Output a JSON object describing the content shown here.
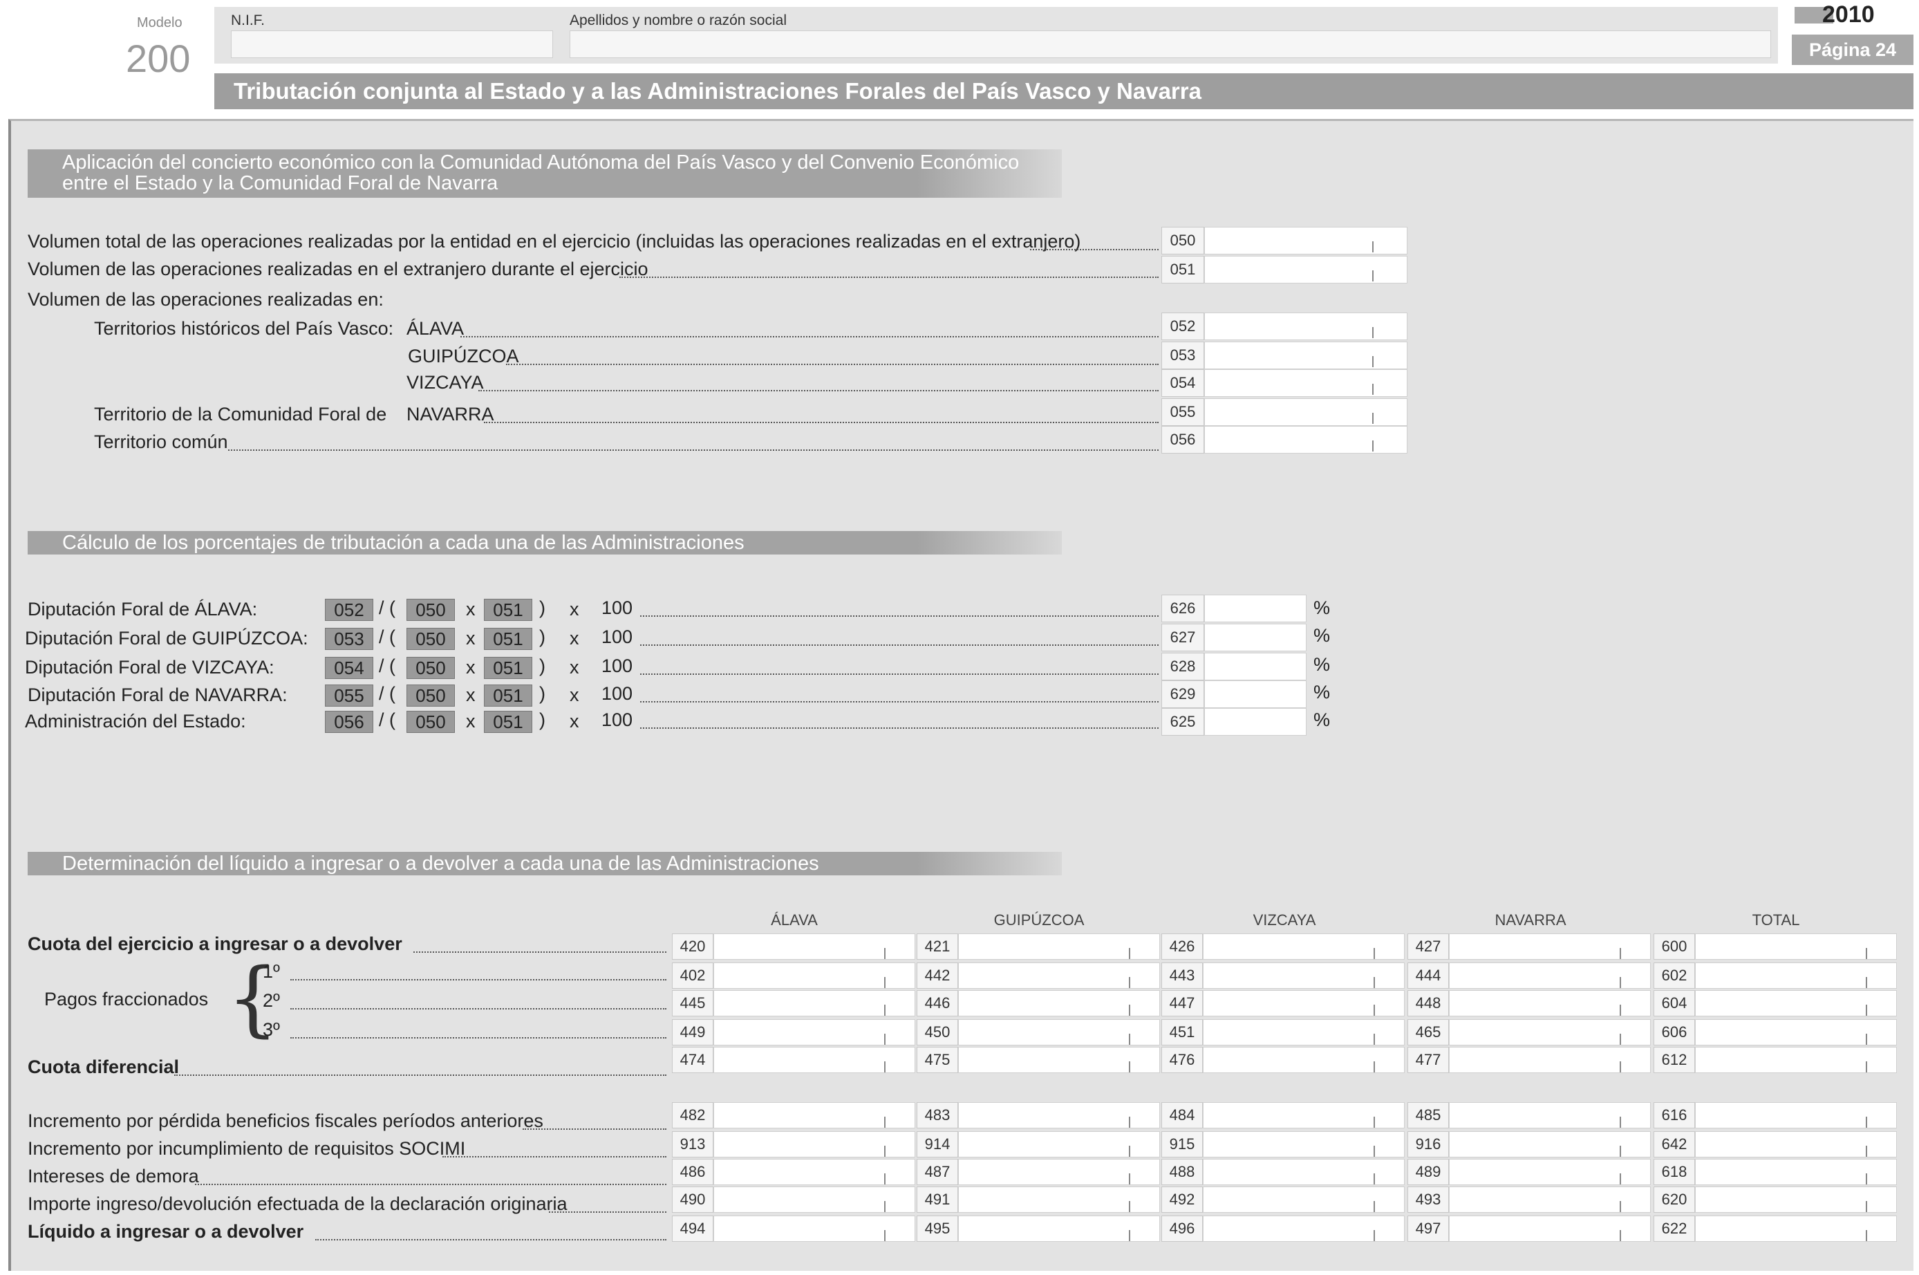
{
  "header": {
    "modelo_label": "Modelo",
    "modelo_number": "200",
    "nif_label": "N.I.F.",
    "name_label": "Apellidos y nombre o razón social",
    "year": "2010",
    "page": "Página 24",
    "title": "Tributación conjunta al Estado y a las Administraciones Forales del País Vasco y Navarra"
  },
  "section1": {
    "title_line1": "Aplicación del concierto económico con la Comunidad Autónoma del País Vasco y del Convenio Económico",
    "title_line2": "entre el Estado y la Comunidad Foral de Navarra",
    "rows": [
      {
        "label": "Volumen total de las operaciones realizadas por la entidad en el ejercicio (incluidas las operaciones realizadas en el extranjero)",
        "code": "050"
      },
      {
        "label": "Volumen de las operaciones realizadas en el extranjero durante el ejercicio",
        "code": "051"
      },
      {
        "label": "ÁLAVA",
        "code": "052"
      },
      {
        "label": "GUIPÚZCOA",
        "code": "053"
      },
      {
        "label": "VIZCAYA",
        "code": "054"
      },
      {
        "label": "NAVARRA",
        "code": "055"
      },
      {
        "label": "Territorio común",
        "code": "056"
      }
    ],
    "volumen_label": "Volumen de las operaciones realizadas en:",
    "pais_vasco_label": "Territorios históricos del País Vasco:",
    "navarra_label": "Territorio de la Comunidad Foral  de"
  },
  "section2": {
    "title": "Cálculo de los porcentajes de tributación a cada una de las Administraciones",
    "rows": [
      {
        "label": "Diputación Foral de ÁLAVA:",
        "ref": "052",
        "a": "050",
        "b": "051",
        "mult": "100",
        "code": "626",
        "unit": "%"
      },
      {
        "label": "Diputación Foral de GUIPÚZCOA:",
        "ref": "053",
        "a": "050",
        "b": "051",
        "mult": "100",
        "code": "627",
        "unit": "%"
      },
      {
        "label": "Diputación Foral de VIZCAYA:",
        "ref": "054",
        "a": "050",
        "b": "051",
        "mult": "100",
        "code": "628",
        "unit": "%"
      },
      {
        "label": "Diputación Foral de NAVARRA:",
        "ref": "055",
        "a": "050",
        "b": "051",
        "mult": "100",
        "code": "629",
        "unit": "%"
      },
      {
        "label": "Administración del Estado:",
        "ref": "056",
        "a": "050",
        "b": "051",
        "mult": "100",
        "code": "625",
        "unit": "%"
      }
    ],
    "op_div": "/ (",
    "op_x": "x",
    "op_close": ")"
  },
  "section3": {
    "title": "Determinación del líquido a ingresar o a devolver a cada una de las Administraciones",
    "columns": [
      "ÁLAVA",
      "GUIPÚZCOA",
      "VIZCAYA",
      "NAVARRA",
      "TOTAL"
    ],
    "cuota_label": "Cuota del ejercicio a ingresar o a devolver",
    "pagos_label": "Pagos fraccionados",
    "p1": "1º",
    "p2": "2º",
    "p3": "3º",
    "cuota_dif_label": "Cuota diferencial",
    "inc1_label": "Incremento por pérdida beneficios fiscales períodos anteriores",
    "inc2_label": "Incremento por incumplimiento de requisitos SOCIMI",
    "intereses_label": "Intereses de demora",
    "importe_label": "Importe ingreso/devolución efectuada de la declaración originaria",
    "liquido_label": "Líquido a ingresar o a devolver",
    "codes": [
      [
        "420",
        "421",
        "426",
        "427",
        "600"
      ],
      [
        "402",
        "442",
        "443",
        "444",
        "602"
      ],
      [
        "445",
        "446",
        "447",
        "448",
        "604"
      ],
      [
        "449",
        "450",
        "451",
        "465",
        "606"
      ],
      [
        "474",
        "475",
        "476",
        "477",
        "612"
      ],
      [
        "482",
        "483",
        "484",
        "485",
        "616"
      ],
      [
        "913",
        "914",
        "915",
        "916",
        "642"
      ],
      [
        "486",
        "487",
        "488",
        "489",
        "618"
      ],
      [
        "490",
        "491",
        "492",
        "493",
        "620"
      ],
      [
        "494",
        "495",
        "496",
        "497",
        "622"
      ]
    ]
  }
}
